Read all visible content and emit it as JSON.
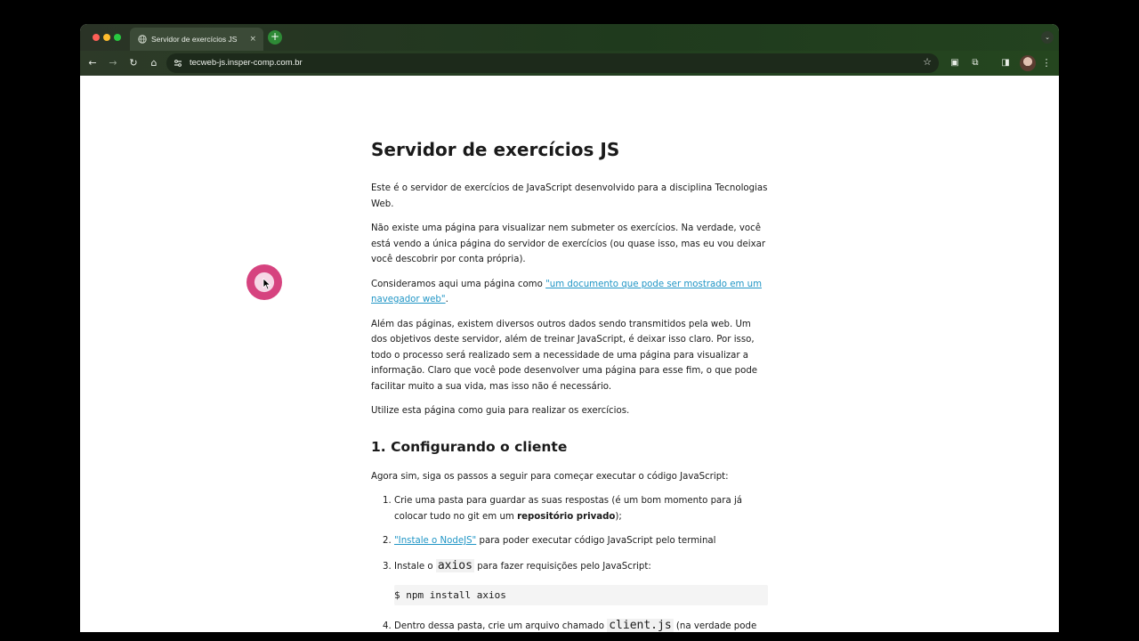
{
  "browser": {
    "tab_title": "Servidor de exercícios JS",
    "tab_close": "×",
    "new_tab": "+",
    "tab_menu": "⌄",
    "url": "tecweb-js.insper-comp.com.br",
    "nav": {
      "back": "←",
      "forward": "→",
      "reload": "↻",
      "home": "⌂"
    },
    "bookmark": "☆",
    "toolbar_icons": {
      "ext1": "▣",
      "ext2": "⧉",
      "sidebar": "◨",
      "menu": "⋮"
    }
  },
  "page": {
    "title": "Servidor de exercícios JS",
    "p1": "Este é o servidor de exercícios de JavaScript desenvolvido para a disciplina Tecnologias Web.",
    "p2": "Não existe uma página para visualizar nem submeter os exercícios. Na verdade, você está vendo a única página do servidor de exercícios (ou quase isso, mas eu vou deixar você descobrir por conta própria).",
    "p3_before": "Consideramos aqui uma página como ",
    "p3_link": "\"um documento que pode ser mostrado em um navegador web\"",
    "p3_after": ".",
    "p4": "Além das páginas, existem diversos outros dados sendo transmitidos pela web. Um dos objetivos deste servidor, além de treinar JavaScript, é deixar isso claro. Por isso, todo o processo será realizado sem a necessidade de uma página para visualizar a informação. Claro que você pode desenvolver uma página para esse fim, o que pode facilitar muito a sua vida, mas isso não é necessário.",
    "p5": "Utilize esta página como guia para realizar os exercícios.",
    "section1_title": "1. Configurando o cliente",
    "section1_intro": "Agora sim, siga os passos a seguir para começar executar o código JavaScript:",
    "steps": {
      "s1_before": "Crie uma pasta para guardar as suas respostas (é um bom momento para já colocar tudo no git em um ",
      "s1_bold": "repositório privado",
      "s1_after": ");",
      "s2_link": "\"Instale o NodeJS\"",
      "s2_after": " para poder executar código JavaScript pelo terminal",
      "s3_before": "Instale o ",
      "s3_code": "axios",
      "s3_after": " para fazer requisições pelo JavaScript:",
      "s3_block": "$ npm install axios",
      "s4_before": "Dentro dessa pasta, crie um arquivo chamado ",
      "s4_code": "client.js",
      "s4_after": " (na verdade pode ter"
    }
  }
}
